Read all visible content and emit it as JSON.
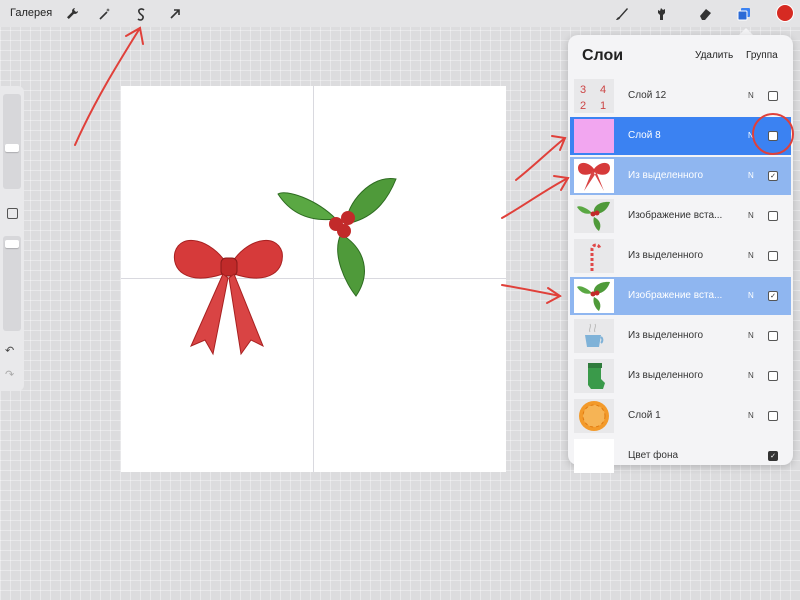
{
  "topbar": {
    "gallery_label": "Галерея",
    "left_icons": [
      "wrench-icon",
      "magic-wand-icon",
      "selection-s-icon",
      "arrow-cursor-icon"
    ],
    "right_icons": [
      "brush-icon",
      "smudge-icon",
      "eraser-icon",
      "layers-icon"
    ],
    "active_color": "#d62a22"
  },
  "sidebar": {
    "icons": [
      "modify-square-icon",
      "undo-icon",
      "redo-icon"
    ]
  },
  "layers_panel": {
    "title": "Слои",
    "delete_label": "Удалить",
    "group_label": "Группа",
    "layers": [
      {
        "name": "Слой 12",
        "blend": "N",
        "visible": false,
        "state": "normal",
        "thumb": "numbers"
      },
      {
        "name": "Слой 8",
        "blend": "N",
        "visible": false,
        "state": "selected",
        "thumb": "pink"
      },
      {
        "name": "Из выделенного",
        "blend": "N",
        "visible": true,
        "state": "secondary",
        "thumb": "bow"
      },
      {
        "name": "Изображение вста...",
        "blend": "N",
        "visible": false,
        "state": "normal",
        "thumb": "holly"
      },
      {
        "name": "Из выделенного",
        "blend": "N",
        "visible": false,
        "state": "normal",
        "thumb": "candy-cane"
      },
      {
        "name": "Изображение вста...",
        "blend": "N",
        "visible": true,
        "state": "secondary",
        "thumb": "holly"
      },
      {
        "name": "Из выделенного",
        "blend": "N",
        "visible": false,
        "state": "normal",
        "thumb": "cup"
      },
      {
        "name": "Из выделенного",
        "blend": "N",
        "visible": false,
        "state": "normal",
        "thumb": "stocking"
      },
      {
        "name": "Слой 1",
        "blend": "N",
        "visible": false,
        "state": "normal",
        "thumb": "orange"
      },
      {
        "name": "Цвет фона",
        "blend": "",
        "visible": true,
        "state": "background",
        "thumb": "white"
      }
    ]
  },
  "colors": {
    "selected": "#3b82f2",
    "secondary": "#8fb6f0",
    "annotation": "#e0403a"
  }
}
